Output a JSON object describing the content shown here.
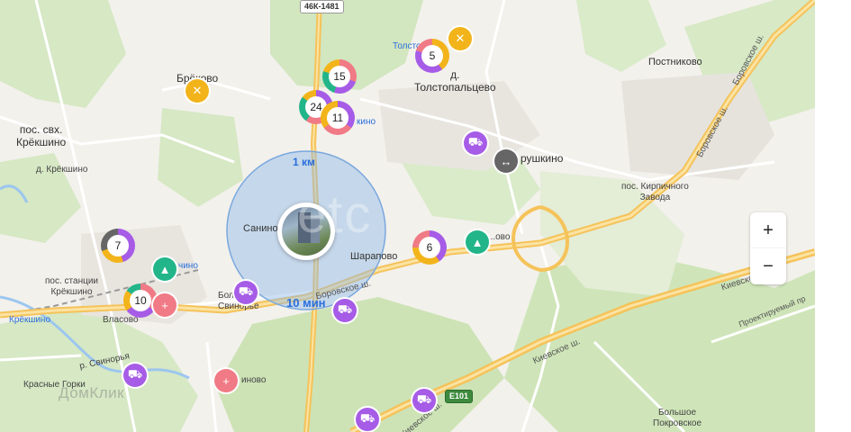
{
  "map": {
    "places": {
      "brekovo": "Брёково",
      "kreksino_sett": "пос. свх.\nКрёкшино",
      "kreksino_stn": "д. Крёкшино",
      "kreksino_rail": "пос. станции\nКрёкшино",
      "kreksino_bottom": "Крёкшино",
      "tolstopaltsevo_top": "Толстоп",
      "tolstopaltsevo": "д.\nТолстопальцево",
      "postnikovo": "Постниково",
      "rushkino": "рушкино",
      "kirpich": "пос. Кирпичного\nЗавода",
      "sanino": "Санино",
      "sharapovo": "Шарапово",
      "bolshoe_svinorye": "Бол\nСвинорье",
      "vlasovo": "Власово",
      "krasnye_gorki": "Красные Горки",
      "inovo": "иново",
      "bolshoe_pokrovskoe": "Большое\nПокровское",
      "dovo": "Д...ово",
      "chino": "чино",
      "kino": "кино",
      "svinorya": "р. Свинорья"
    },
    "roads": {
      "borovskoe_1": "Боровское ш.",
      "borovskoe_2": "Боровское ш.",
      "borovskoe_3": "Боровское ш.",
      "kievskoe_1": "Киевское ш.",
      "kievskoe_2": "Киевское ш.",
      "kievskoe_3": "Киевское ш.",
      "proektiruemy": "Проектируемый пр",
      "shield_46k": "46К-1481",
      "shield_e101": "E101"
    },
    "isochrone": {
      "distance_label": "1 км",
      "time_label": "10 мин"
    },
    "clusters": [
      {
        "count": "15"
      },
      {
        "count": "24"
      },
      {
        "count": "11"
      },
      {
        "count": "5"
      },
      {
        "count": "7"
      },
      {
        "count": "10"
      },
      {
        "count": "6"
      }
    ],
    "icons": {
      "shop": "shopping-cart-icon",
      "food": "restaurant-icon",
      "school": "school-icon",
      "medical": "medical-icon",
      "transport_hub": "transport-hub-icon"
    },
    "watermark": "ДомКлик",
    "watermark_center": "etc"
  },
  "controls": {
    "zoom_in": "+",
    "zoom_out": "−"
  },
  "colors": {
    "shop": "#a65ce6",
    "food": "#f2b41a",
    "school": "#23b58a",
    "medical": "#f07a85",
    "isochrone": "#8fb8e8",
    "highway": "#f5c35a"
  }
}
